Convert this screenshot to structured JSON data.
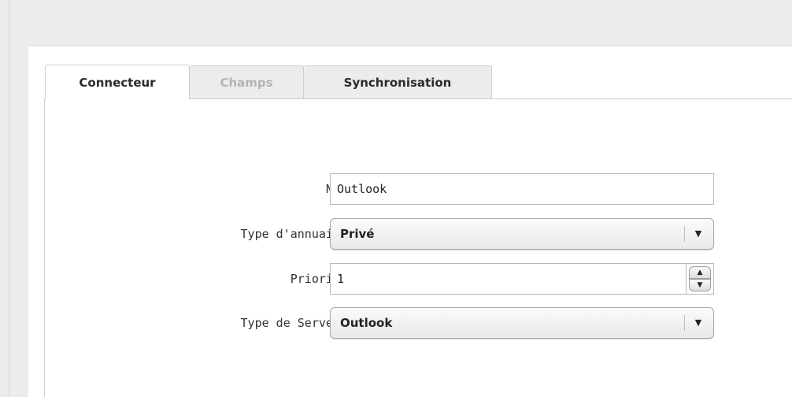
{
  "tabs": [
    {
      "label": "Connecteur",
      "state": "active"
    },
    {
      "label": "Champs",
      "state": "disabled"
    },
    {
      "label": "Synchronisation",
      "state": "normal"
    }
  ],
  "form": {
    "nom": {
      "label": "Nom",
      "value": "Outlook"
    },
    "type_annuaire": {
      "label": "Type d'annuaire",
      "value": "Privé",
      "arrow_icon": "triangle-down"
    },
    "priorite": {
      "label": "Priorité",
      "value": "1",
      "up_icon": "triangle-up",
      "down_icon": "triangle-down"
    },
    "type_serveur": {
      "label": "Type de Serveur",
      "value": "Outlook",
      "arrow_icon": "triangle-down"
    }
  },
  "colors": {
    "background": "#ececec",
    "panel": "#ffffff",
    "border": "#cfcfcf",
    "disabled_text": "#b4b4b4"
  }
}
